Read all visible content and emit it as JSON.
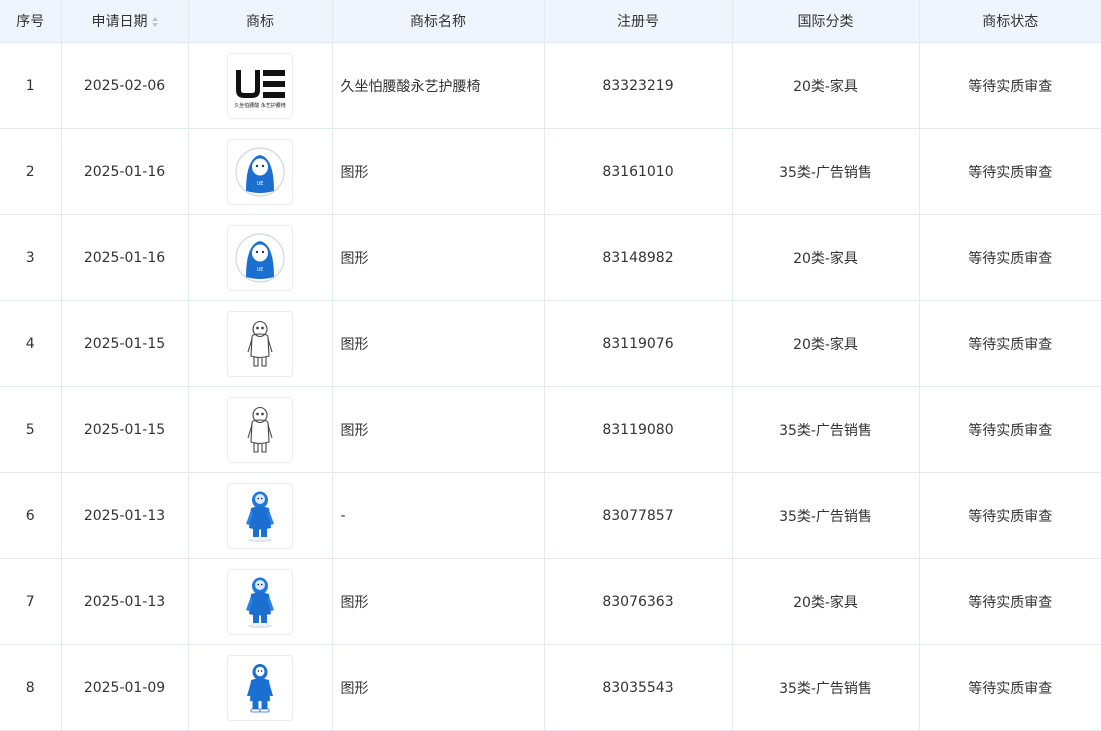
{
  "columns": {
    "index": "序号",
    "date": "申请日期",
    "logo": "商标",
    "name": "商标名称",
    "reg_no": "注册号",
    "class": "国际分类",
    "status": "商标状态"
  },
  "rows": [
    {
      "index": "1",
      "date": "2025-02-06",
      "logo_icon": "ue-logo",
      "logo_subtext": "久坐怕腰酸 永艺护腰椅",
      "name": "久坐怕腰酸永艺护腰椅",
      "reg_no": "83323219",
      "class": "20类-家具",
      "status": "等待实质审查"
    },
    {
      "index": "2",
      "date": "2025-01-16",
      "logo_icon": "blue-character-circle-icon",
      "logo_badge": "UE",
      "name": "图形",
      "reg_no": "83161010",
      "class": "35类-广告销售",
      "status": "等待实质审查"
    },
    {
      "index": "3",
      "date": "2025-01-16",
      "logo_icon": "blue-character-circle-icon",
      "logo_badge": "UE",
      "name": "图形",
      "reg_no": "83148982",
      "class": "20类-家具",
      "status": "等待实质审查"
    },
    {
      "index": "4",
      "date": "2025-01-15",
      "logo_icon": "outline-character-icon",
      "name": "图形",
      "reg_no": "83119076",
      "class": "20类-家具",
      "status": "等待实质审查"
    },
    {
      "index": "5",
      "date": "2025-01-15",
      "logo_icon": "outline-character-icon",
      "name": "图形",
      "reg_no": "83119080",
      "class": "35类-广告销售",
      "status": "等待实质审查"
    },
    {
      "index": "6",
      "date": "2025-01-13",
      "logo_icon": "blue-3d-character-icon",
      "name": "-",
      "reg_no": "83077857",
      "class": "35类-广告销售",
      "status": "等待实质审查"
    },
    {
      "index": "7",
      "date": "2025-01-13",
      "logo_icon": "blue-3d-character-icon",
      "name": "图形",
      "reg_no": "83076363",
      "class": "20类-家具",
      "status": "等待实质审查"
    },
    {
      "index": "8",
      "date": "2025-01-09",
      "logo_icon": "blue-flat-character-icon",
      "name": "图形",
      "reg_no": "83035543",
      "class": "35类-广告销售",
      "status": "等待实质审查"
    }
  ],
  "colors": {
    "header_bg": "#eef5fc",
    "border": "#e3e9ef",
    "character_blue": "#1a6fd0",
    "text": "#333333"
  }
}
